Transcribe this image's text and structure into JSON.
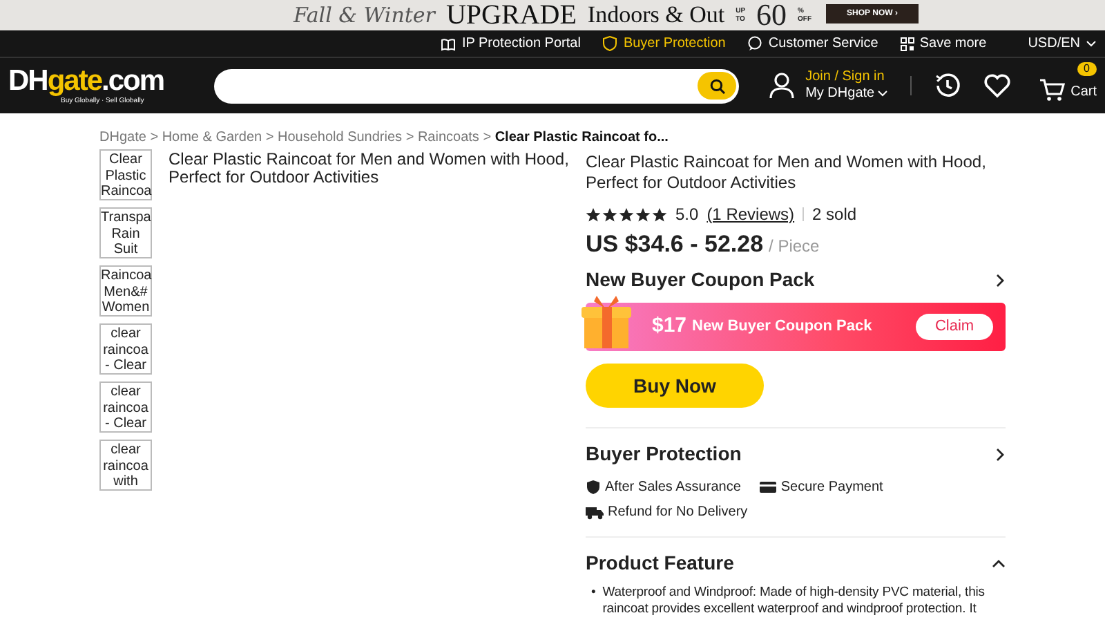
{
  "promo_banner": {
    "script_text": "Fall & Winter",
    "headline": "UPGRADE",
    "subline": "Indoors & Out",
    "up_to": [
      "UP",
      "TO"
    ],
    "percent": "60",
    "off": [
      "%",
      "OFF"
    ],
    "button": "SHOP NOW ›"
  },
  "top_links": [
    {
      "label": "IP Protection Portal",
      "highlighted": false
    },
    {
      "label": "Buyer Protection",
      "highlighted": true
    },
    {
      "label": "Customer Service",
      "highlighted": false
    },
    {
      "label": "Save more",
      "highlighted": false
    }
  ],
  "currency": "USD/EN",
  "logo": {
    "main": "DH",
    "accent": "gate",
    "suffix": ".com",
    "tagline": "Buy Globally · Sell Globally"
  },
  "account": {
    "join": "Join / Sign in",
    "my": "My DHgate"
  },
  "cart": {
    "count": "0",
    "label": "Cart"
  },
  "breadcrumb": [
    {
      "label": "DHgate",
      "current": false
    },
    {
      "separator": ">",
      "label": "Home & Garden",
      "current": false
    },
    {
      "separator": ">",
      "label": "Household Sundries",
      "current": false
    },
    {
      "separator": ">",
      "label": "Raincoats",
      "current": false
    },
    {
      "separator": ">",
      "label": "Clear Plastic Raincoat fo...",
      "current": true
    }
  ],
  "thumbnails": [
    {
      "lines": [
        "Clear",
        "Plastic",
        "Raincoa"
      ]
    },
    {
      "lines": [
        "Transpa",
        "Rain",
        "Suit"
      ]
    },
    {
      "lines": [
        "Raincoa",
        "Men&#",
        "Women"
      ]
    },
    {
      "lines": [
        "clear",
        "raincoa",
        "- Clear"
      ]
    },
    {
      "lines": [
        "clear",
        "raincoa",
        "- Clear"
      ]
    },
    {
      "lines": [
        "clear",
        "raincoa",
        "with"
      ]
    }
  ],
  "image_alt": "Clear Plastic Raincoat for Men and Women with Hood, Perfect for Outdoor Activities",
  "product": {
    "title": "Clear Plastic Raincoat for Men and Women with Hood, Perfect for Outdoor Activities",
    "stars": 5,
    "rating": "5.0",
    "reviews": "(1 Reviews)",
    "sold": "2 sold",
    "price": "US $34.6 - 52.28",
    "unit": "/ Piece"
  },
  "coupon": {
    "heading": "New Buyer Coupon Pack",
    "amount": "$17",
    "label": "New Buyer Coupon Pack",
    "button": "Claim"
  },
  "buy_button": "Buy Now",
  "buyer_protection": {
    "heading": "Buyer Protection",
    "items": [
      {
        "label": "After Sales Assurance"
      },
      {
        "label": "Secure Payment"
      },
      {
        "label": "Refund for No Delivery"
      }
    ]
  },
  "product_feature": {
    "heading": "Product Feature",
    "expanded": true,
    "bullets": [
      {
        "marker": "•",
        "text": "Waterproof and Windproof: Made of high-density PVC material, this raincoat provides excellent waterproof and windproof protection. It"
      }
    ]
  }
}
